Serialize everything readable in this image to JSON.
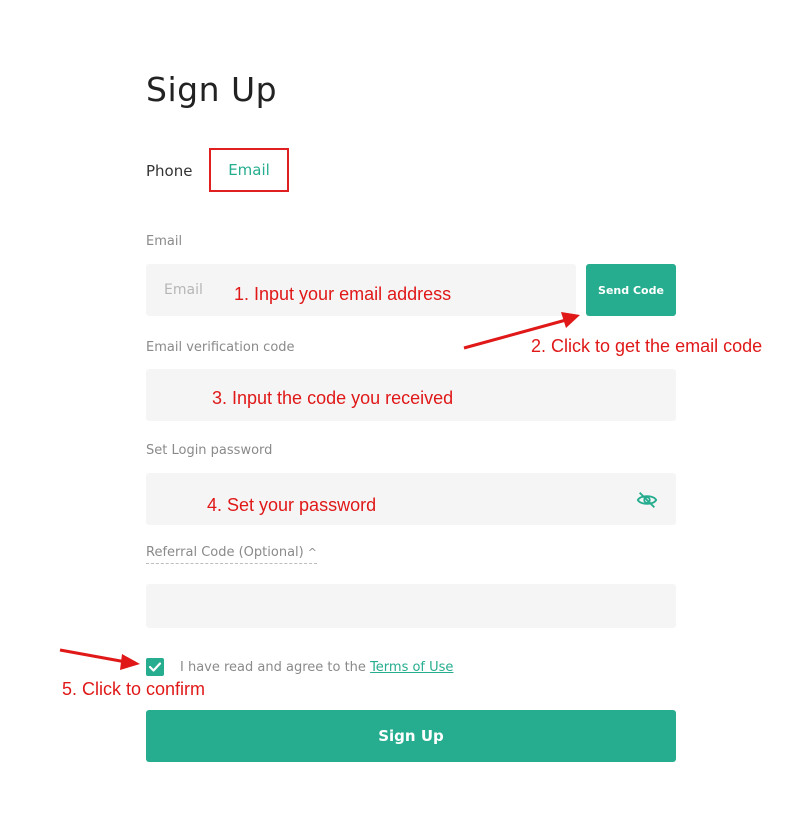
{
  "page": {
    "title": "Sign Up"
  },
  "tabs": [
    {
      "label": "Phone"
    },
    {
      "label": "Email",
      "active": true
    }
  ],
  "form": {
    "email_label": "Email",
    "email_placeholder": "Email",
    "send_code_label": "Send Code",
    "code_label": "Email verification code",
    "password_label": "Set Login password",
    "referral_label": "Referral Code (Optional)",
    "referral_caret": "^",
    "terms_prefix": "I have read and agree to the ",
    "terms_link": "Terms of Use",
    "checkbox_checked": true,
    "submit_label": "Sign Up"
  },
  "annotations": {
    "step1": "1. Input your email address",
    "step2": "2. Click to get the email code",
    "step3": "3. Input the code you received",
    "step4": "4. Set your password",
    "step5": "5. Click to confirm"
  },
  "colors": {
    "accent": "#26ad8f",
    "annotation": "#e01818",
    "field_bg": "#f5f5f5"
  },
  "icons": {
    "password_toggle": "eye-off-icon",
    "checkbox": "check-icon",
    "referral_toggle": "chevron-up-icon"
  }
}
